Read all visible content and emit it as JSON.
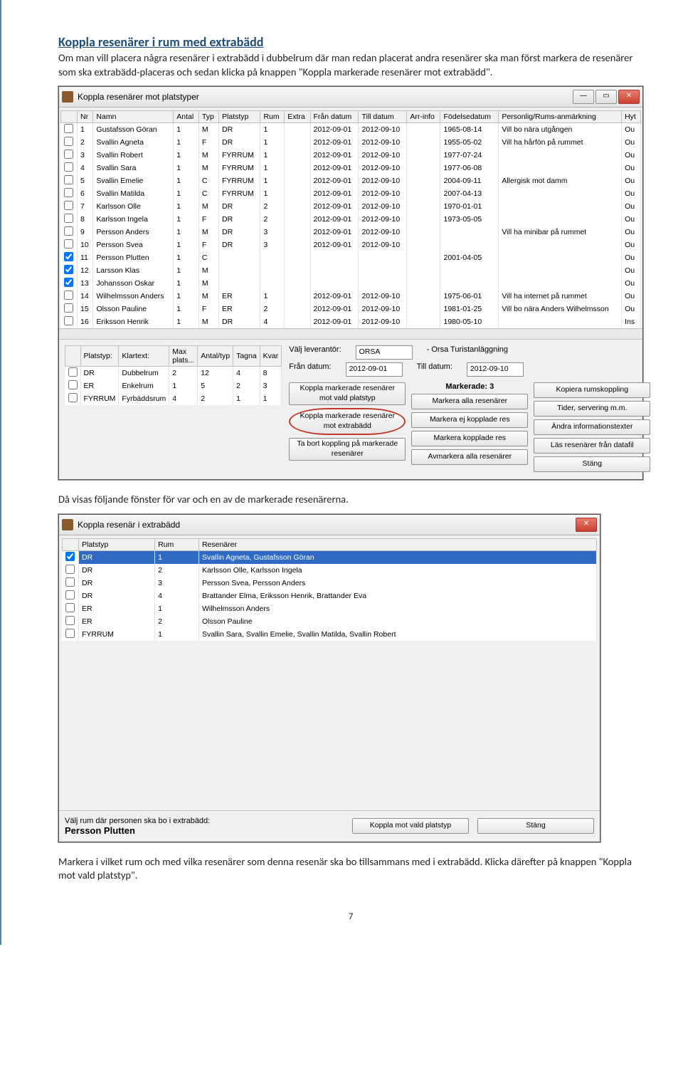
{
  "section_title": "Koppla resenärer i rum med extrabädd",
  "intro": "Om man vill placera några resenärer i extrabädd i dubbelrum där man redan placerat andra resenärer ska man först markera de resenärer som ska extrabädd-placeras och sedan klicka på knappen \"Koppla markerade resenärer mot extrabädd\".",
  "between": "Då visas följande fönster för var och en av de markerade resenärerna.",
  "after": "Markera i vilket rum och med vilka resenärer som denna resenär ska bo tillsammans med i extrabädd. Klicka därefter på knappen \"Koppla mot vald platstyp\".",
  "page_number": "7",
  "dlg1": {
    "title": "Koppla resenärer mot platstyper",
    "cols": [
      "Nr",
      "Namn",
      "Antal",
      "Typ",
      "Platstyp",
      "Rum",
      "Extra",
      "Från datum",
      "Till datum",
      "Arr-info",
      "Födelsedatum",
      "Personlig/Rums-anmärkning",
      "Hyt"
    ],
    "rows": [
      {
        "nr": "1",
        "namn": "Gustafsson Göran",
        "antal": "1",
        "typ": "M",
        "pt": "DR",
        "rum": "1",
        "extra": "",
        "fran": "2012-09-01",
        "till": "2012-09-10",
        "fod": "1965-08-14",
        "anm": "Vill bo nära utgången",
        "hyt": "Ou"
      },
      {
        "nr": "2",
        "namn": "Svallin Agneta",
        "antal": "1",
        "typ": "F",
        "pt": "DR",
        "rum": "1",
        "extra": "",
        "fran": "2012-09-01",
        "till": "2012-09-10",
        "fod": "1955-05-02",
        "anm": "Vill ha hårfön på rummet",
        "hyt": "Ou"
      },
      {
        "nr": "3",
        "namn": "Svallin Robert",
        "antal": "1",
        "typ": "M",
        "pt": "FYRRUM",
        "rum": "1",
        "extra": "",
        "fran": "2012-09-01",
        "till": "2012-09-10",
        "fod": "1977-07-24",
        "anm": "",
        "hyt": "Ou"
      },
      {
        "nr": "4",
        "namn": "Svallin Sara",
        "antal": "1",
        "typ": "M",
        "pt": "FYRRUM",
        "rum": "1",
        "extra": "",
        "fran": "2012-09-01",
        "till": "2012-09-10",
        "fod": "1977-06-08",
        "anm": "",
        "hyt": "Ou"
      },
      {
        "nr": "5",
        "namn": "Svallin Emelie",
        "antal": "1",
        "typ": "C",
        "pt": "FYRRUM",
        "rum": "1",
        "extra": "",
        "fran": "2012-09-01",
        "till": "2012-09-10",
        "fod": "2004-09-11",
        "anm": "Allergisk mot damm",
        "hyt": "Ou"
      },
      {
        "nr": "6",
        "namn": "Svallin Matilda",
        "antal": "1",
        "typ": "C",
        "pt": "FYRRUM",
        "rum": "1",
        "extra": "",
        "fran": "2012-09-01",
        "till": "2012-09-10",
        "fod": "2007-04-13",
        "anm": "",
        "hyt": "Ou"
      },
      {
        "nr": "7",
        "namn": "Karlsson Olle",
        "antal": "1",
        "typ": "M",
        "pt": "DR",
        "rum": "2",
        "extra": "",
        "fran": "2012-09-01",
        "till": "2012-09-10",
        "fod": "1970-01-01",
        "anm": "",
        "hyt": "Ou"
      },
      {
        "nr": "8",
        "namn": "Karlsson Ingela",
        "antal": "1",
        "typ": "F",
        "pt": "DR",
        "rum": "2",
        "extra": "",
        "fran": "2012-09-01",
        "till": "2012-09-10",
        "fod": "1973-05-05",
        "anm": "",
        "hyt": "Ou"
      },
      {
        "nr": "9",
        "namn": "Persson Anders",
        "antal": "1",
        "typ": "M",
        "pt": "DR",
        "rum": "3",
        "extra": "",
        "fran": "2012-09-01",
        "till": "2012-09-10",
        "fod": "",
        "anm": "Vill ha minibar på rummet",
        "hyt": "Ou"
      },
      {
        "nr": "10",
        "namn": "Persson Svea",
        "antal": "1",
        "typ": "F",
        "pt": "DR",
        "rum": "3",
        "extra": "",
        "fran": "2012-09-01",
        "till": "2012-09-10",
        "fod": "",
        "anm": "",
        "hyt": "Ou"
      },
      {
        "nr": "11",
        "namn": "Persson Plutten",
        "antal": "1",
        "typ": "C",
        "pt": "",
        "rum": "",
        "extra": "",
        "fran": "",
        "till": "",
        "fod": "2001-04-05",
        "anm": "",
        "hyt": "Ou",
        "checked": true
      },
      {
        "nr": "12",
        "namn": "Larsson Klas",
        "antal": "1",
        "typ": "M",
        "pt": "",
        "rum": "",
        "extra": "",
        "fran": "",
        "till": "",
        "fod": "",
        "anm": "",
        "hyt": "Ou",
        "checked": true
      },
      {
        "nr": "13",
        "namn": "Johansson Oskar",
        "antal": "1",
        "typ": "M",
        "pt": "",
        "rum": "",
        "extra": "",
        "fran": "",
        "till": "",
        "fod": "",
        "anm": "",
        "hyt": "Ou",
        "checked": true
      },
      {
        "nr": "14",
        "namn": "Wilhelmsson Anders",
        "antal": "1",
        "typ": "M",
        "pt": "ER",
        "rum": "1",
        "extra": "",
        "fran": "2012-09-01",
        "till": "2012-09-10",
        "fod": "1975-06-01",
        "anm": "Vill ha internet på rummet",
        "hyt": "Ou"
      },
      {
        "nr": "15",
        "namn": "Olsson Pauline",
        "antal": "1",
        "typ": "F",
        "pt": "ER",
        "rum": "2",
        "extra": "",
        "fran": "2012-09-01",
        "till": "2012-09-10",
        "fod": "1981-01-25",
        "anm": "Vill bo nära Anders Wilhelmsson",
        "hyt": "Ou"
      },
      {
        "nr": "16",
        "namn": "Eriksson Henrik",
        "antal": "1",
        "typ": "M",
        "pt": "DR",
        "rum": "4",
        "extra": "",
        "fran": "2012-09-01",
        "till": "2012-09-10",
        "fod": "1980-05-10",
        "anm": "",
        "hyt": "Ins"
      }
    ],
    "pt_block": {
      "hdr": [
        "Platstyp:",
        "Klartext:",
        "Max plats...",
        "Antal/typ",
        "Tagna",
        "Kvar"
      ],
      "rows": [
        {
          "pt": "DR",
          "kt": "Dubbelrum",
          "max": "2",
          "ant": "12",
          "tag": "4",
          "kvar": "8"
        },
        {
          "pt": "ER",
          "kt": "Enkelrum",
          "max": "1",
          "ant": "5",
          "tag": "2",
          "kvar": "3"
        },
        {
          "pt": "FYRRUM",
          "kt": "Fyrbäddsrum",
          "max": "4",
          "ant": "2",
          "tag": "1",
          "kvar": "1"
        }
      ]
    },
    "supplier_lbl": "Välj leverantör:",
    "supplier_val": "ORSA",
    "supplier_desc": "- Orsa Turistanläggning",
    "from_lbl": "Från datum:",
    "from_val": "2012-09-01",
    "to_lbl": "Till datum:",
    "to_val": "2012-09-10",
    "marked_lbl": "Markerade: 3",
    "buttons_col1": [
      "Koppla markerade resenärer mot vald platstyp",
      "Koppla markerade resenärer mot extrabädd",
      "Ta bort koppling på markerade resenärer"
    ],
    "buttons_col2": [
      "Markera alla resenärer",
      "Markera ej kopplade res",
      "Markera kopplade res",
      "Avmarkera alla resenärer"
    ],
    "buttons_col3": [
      "Kopiera rumskoppling",
      "Tider, servering m.m.",
      "Ändra informationstexter",
      "Läs resenärer från datafil",
      "Stäng"
    ]
  },
  "dlg2": {
    "title": "Koppla resenär i extrabädd",
    "cols": [
      "Platstyp",
      "Rum",
      "Resenärer"
    ],
    "rows": [
      {
        "pt": "DR",
        "rum": "1",
        "res": "Svallin Agneta, Gustafsson Göran",
        "sel": true
      },
      {
        "pt": "DR",
        "rum": "2",
        "res": "Karlsson Olle, Karlsson Ingela"
      },
      {
        "pt": "DR",
        "rum": "3",
        "res": "Persson Svea, Persson Anders"
      },
      {
        "pt": "DR",
        "rum": "4",
        "res": "Brattander Elma, Eriksson Henrik, Brattander Eva"
      },
      {
        "pt": "ER",
        "rum": "1",
        "res": "Wilhelmsson Anders"
      },
      {
        "pt": "ER",
        "rum": "2",
        "res": "Olsson Pauline"
      },
      {
        "pt": "FYRRUM",
        "rum": "1",
        "res": "Svallin Sara, Svallin Emelie, Svallin Matilda, Svallin Robert"
      }
    ],
    "prompt": "Välj rum där personen ska bo i extrabädd:",
    "person": "Persson Plutten",
    "btn_koppla": "Koppla mot vald platstyp",
    "btn_stang": "Stäng"
  }
}
